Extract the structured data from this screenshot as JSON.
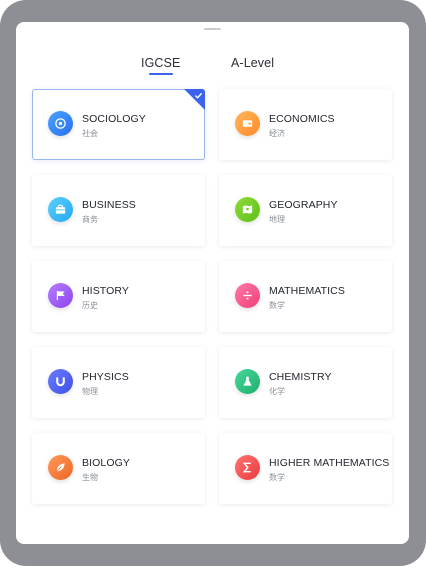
{
  "tabs": [
    {
      "label": "IGCSE",
      "active": true
    },
    {
      "label": "A-Level",
      "active": false
    }
  ],
  "selected_subject": "SOCIOLOGY",
  "colors": {
    "accent": "#3b63f0",
    "sociology": "#2f7ff0",
    "economics": "#ff9f3a",
    "business": "#36b8f3",
    "geography": "#6fcc22",
    "history": "#9b5cf0",
    "mathematics": "#f2558a",
    "physics": "#4a5ff0",
    "chemistry": "#2ec27e",
    "biology": "#f57d3a",
    "higher_mathematics": "#f25252"
  },
  "subjects": [
    {
      "name": "SOCIOLOGY",
      "cn": "社会",
      "icon": "target-icon",
      "selected": true
    },
    {
      "name": "ECONOMICS",
      "cn": "经济",
      "icon": "wallet-icon",
      "selected": false
    },
    {
      "name": "BUSINESS",
      "cn": "商务",
      "icon": "briefcase-icon",
      "selected": false
    },
    {
      "name": "GEOGRAPHY",
      "cn": "地理",
      "icon": "map-icon",
      "selected": false
    },
    {
      "name": "HISTORY",
      "cn": "历史",
      "icon": "flag-icon",
      "selected": false
    },
    {
      "name": "MATHEMATICS",
      "cn": "数学",
      "icon": "divide-icon",
      "selected": false
    },
    {
      "name": "PHYSICS",
      "cn": "物理",
      "icon": "magnet-icon",
      "selected": false
    },
    {
      "name": "CHEMISTRY",
      "cn": "化学",
      "icon": "flask-icon",
      "selected": false
    },
    {
      "name": "BIOLOGY",
      "cn": "生物",
      "icon": "leaf-icon",
      "selected": false
    },
    {
      "name": "HIGHER MATHEMATICS",
      "cn": "数学",
      "icon": "sigma-icon",
      "selected": false
    }
  ]
}
